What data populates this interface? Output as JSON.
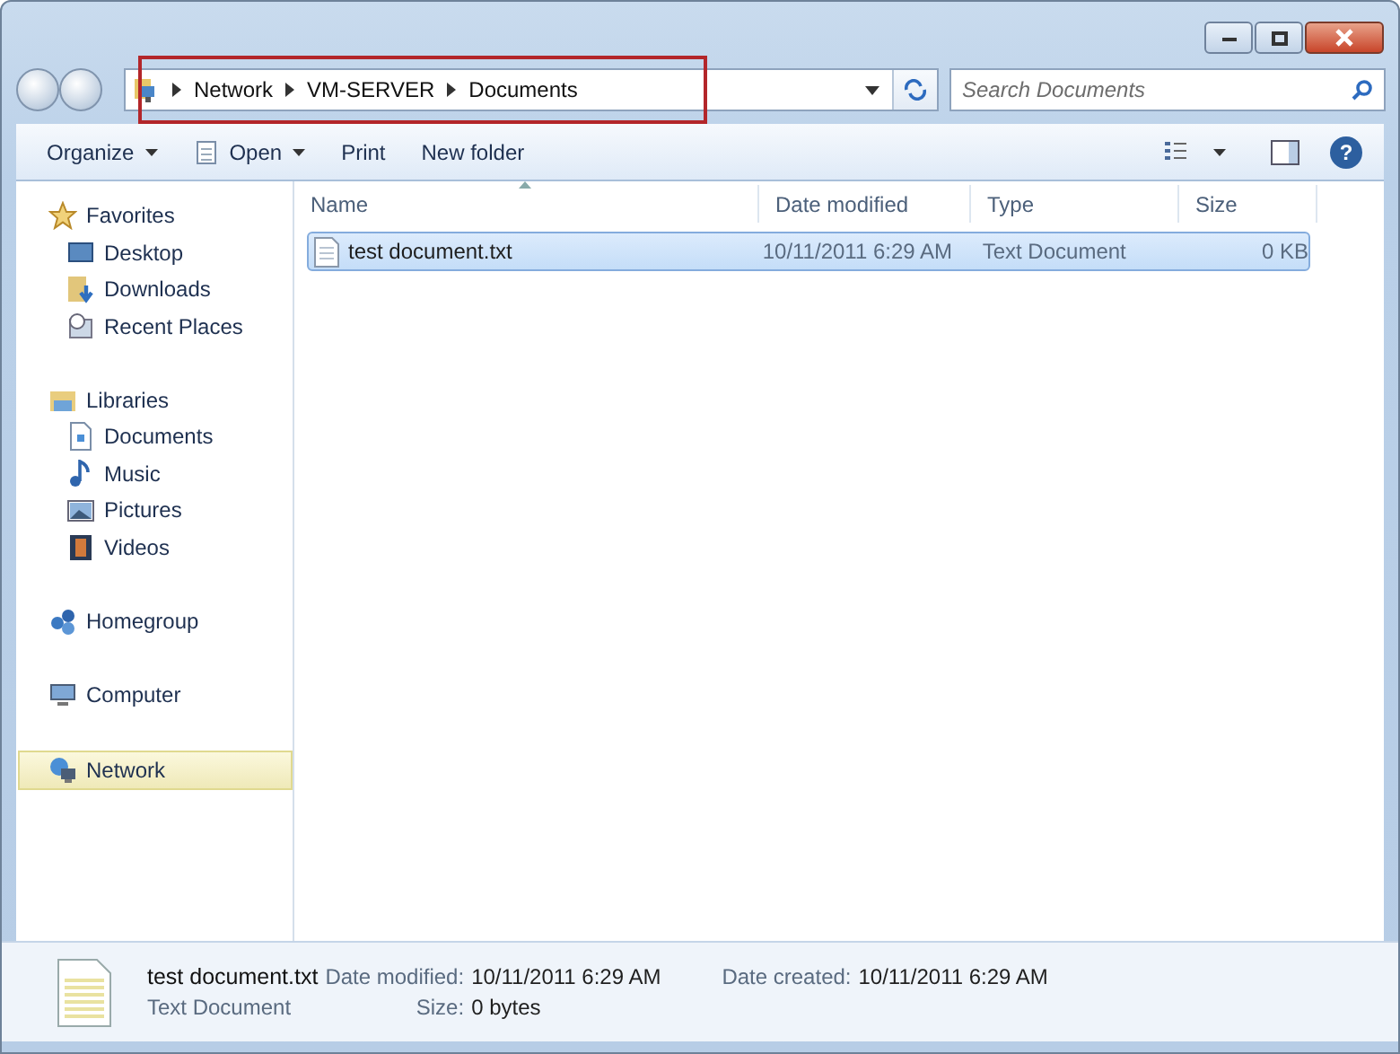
{
  "address": {
    "breadcrumbs": [
      "Network",
      "VM-SERVER",
      "Documents"
    ]
  },
  "search": {
    "placeholder": "Search Documents"
  },
  "toolbar": [
    {
      "label": "Organize",
      "dropdown": true,
      "icon": false
    },
    {
      "label": "Open",
      "dropdown": true,
      "icon": true
    },
    {
      "label": "Print",
      "dropdown": false,
      "icon": false
    },
    {
      "label": "New folder",
      "dropdown": false,
      "icon": false
    }
  ],
  "sidebar": {
    "groups": [
      {
        "label": "Favorites",
        "selected": false,
        "children": [
          {
            "label": "Desktop",
            "selected": false
          },
          {
            "label": "Downloads",
            "selected": false
          },
          {
            "label": "Recent Places",
            "selected": false
          }
        ]
      },
      {
        "label": "Libraries",
        "selected": false,
        "children": [
          {
            "label": "Documents",
            "selected": false
          },
          {
            "label": "Music",
            "selected": false
          },
          {
            "label": "Pictures",
            "selected": false
          },
          {
            "label": "Videos",
            "selected": false
          }
        ]
      },
      {
        "label": "Homegroup",
        "selected": false
      },
      {
        "label": "Computer",
        "selected": false
      },
      {
        "label": "Network",
        "selected": true
      }
    ]
  },
  "help_button": "?",
  "table": {
    "columns": [
      {
        "label": "Name",
        "sorted": true
      },
      {
        "label": "Date modified",
        "sorted": false
      },
      {
        "label": "Type",
        "sorted": false
      },
      {
        "label": "Size",
        "sorted": false
      }
    ],
    "rows": [
      {
        "name": "test document.txt",
        "date_modified": "10/11/2011 6:29 AM",
        "type": "Text Document",
        "size": "0 KB",
        "selected": true
      }
    ]
  },
  "details": {
    "name": "test document.txt",
    "type": "Text Document",
    "fields": [
      {
        "label": "Date modified:",
        "value": "10/11/2011 6:29 AM"
      },
      {
        "label": "Date created:",
        "value": "10/11/2011 6:29 AM"
      },
      {
        "label": "Size:",
        "value": "0 bytes"
      }
    ]
  }
}
